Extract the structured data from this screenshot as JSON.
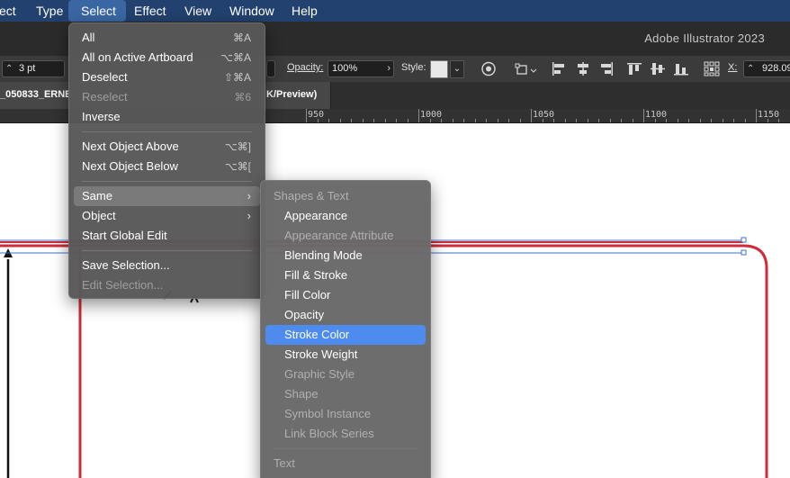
{
  "menubar": {
    "items": [
      "ect",
      "Type",
      "Select",
      "Effect",
      "View",
      "Window",
      "Help"
    ],
    "active": "Select",
    "color": "#22416e"
  },
  "app_title": "Adobe Illustrator 2023",
  "toolbar": {
    "stroke_weight": "3 pt",
    "opacity_label": "Opacity:",
    "opacity_value": "100%",
    "style_label": "Style:",
    "x_label": "X:",
    "x_value": "928.09",
    "icons": [
      "recolor-icon",
      "align-icon",
      "align-left-icon",
      "align-center-h-icon",
      "align-right-icon",
      "align-top-icon",
      "align-center-v-icon",
      "align-bottom-icon",
      "reference-point-icon"
    ]
  },
  "tab": {
    "title_left": "_050833_ERNE",
    "title_right": "K/Preview)"
  },
  "ruler": {
    "labels": [
      "950",
      "1000",
      "1050",
      "1100",
      "1150"
    ]
  },
  "select_menu": {
    "items": [
      {
        "label": "All",
        "shortcut": "⌘A",
        "disabled": false
      },
      {
        "label": "All on Active Artboard",
        "shortcut": "⌥⌘A",
        "disabled": false
      },
      {
        "label": "Deselect",
        "shortcut": "⇧⌘A",
        "disabled": false
      },
      {
        "label": "Reselect",
        "shortcut": "⌘6",
        "disabled": true
      },
      {
        "label": "Inverse",
        "shortcut": "",
        "disabled": false
      },
      {
        "label": "Next Object Above",
        "shortcut": "⌥⌘]",
        "disabled": false
      },
      {
        "label": "Next Object Below",
        "shortcut": "⌥⌘[",
        "disabled": false
      },
      {
        "label": "Same",
        "shortcut": "",
        "submenu": true,
        "highlighted": true
      },
      {
        "label": "Object",
        "shortcut": "",
        "submenu": true
      },
      {
        "label": "Start Global Edit",
        "shortcut": "",
        "disabled": false
      },
      {
        "label": "Save Selection...",
        "shortcut": "",
        "disabled": false
      },
      {
        "label": "Edit Selection...",
        "shortcut": "",
        "disabled": true
      }
    ]
  },
  "same_submenu": {
    "header": "Shapes & Text",
    "items": [
      {
        "label": "Appearance",
        "disabled": false
      },
      {
        "label": "Appearance Attribute",
        "disabled": true
      },
      {
        "label": "Blending Mode",
        "disabled": false
      },
      {
        "label": "Fill & Stroke",
        "disabled": false
      },
      {
        "label": "Fill Color",
        "disabled": false
      },
      {
        "label": "Opacity",
        "disabled": false
      },
      {
        "label": "Stroke Color",
        "disabled": false,
        "selected": true
      },
      {
        "label": "Stroke Weight",
        "disabled": false
      },
      {
        "label": "Graphic Style",
        "disabled": true
      },
      {
        "label": "Shape",
        "disabled": true
      },
      {
        "label": "Symbol Instance",
        "disabled": true
      },
      {
        "label": "Link Block Series",
        "disabled": true
      }
    ],
    "footer_header": "Text",
    "selected_color": "#4d8bef"
  },
  "canvas": {
    "stroke_color": "#d12a3a",
    "selection_color": "#3f6fd0"
  }
}
